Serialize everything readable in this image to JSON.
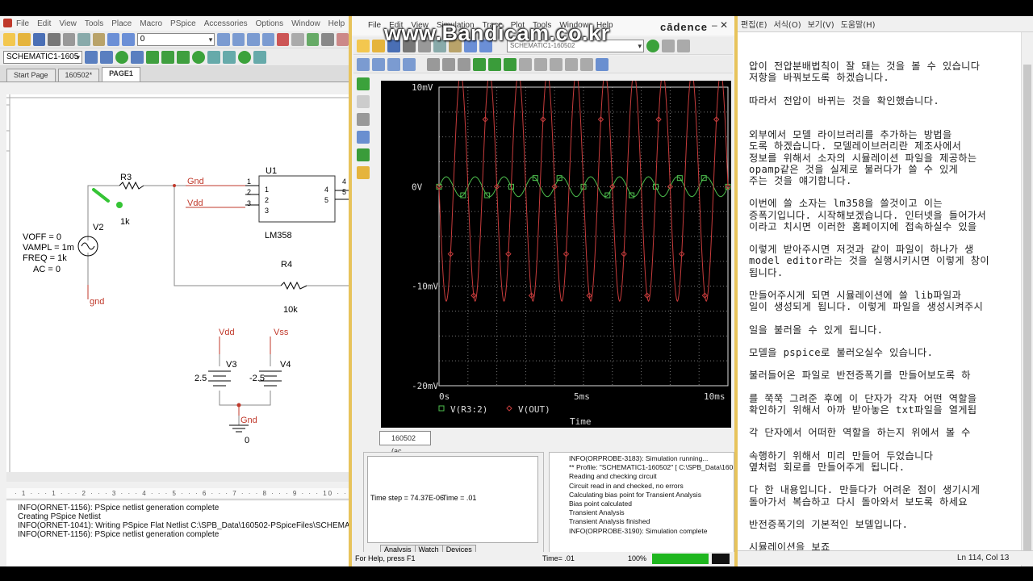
{
  "watermark": "www.Bandicam.co.kr",
  "capture": {
    "menu": [
      "File",
      "Edit",
      "View",
      "Tools",
      "Place",
      "Macro",
      "PSpice",
      "Accessories",
      "Options",
      "Window",
      "Help"
    ],
    "zoom_combo": "0",
    "schematic_combo": "SCHEMATIC1-1605",
    "tabs": [
      "Start Page",
      "160502*",
      "PAGE1"
    ],
    "parts": {
      "R3": "R3",
      "R3_value": "1k",
      "R4": "R4",
      "R4_value": "10k",
      "V2": "V2",
      "V3": "V3",
      "V4": "V4",
      "U1": "U1",
      "U1_model": "LM358",
      "voff": "VOFF = 0",
      "vampl": "VAMPL = 1m",
      "freq": "FREQ = 1k",
      "ac": "AC = 0",
      "v3_value": "2.5",
      "v4_value": "-2.5",
      "pin1": "1",
      "pin2": "2",
      "pin3": "3",
      "pin4": "4",
      "pin5": "5",
      "net_gnd": "Gnd",
      "net_vdd": "Vdd",
      "net_gnd_lower": "gnd",
      "net_vss": "Vss",
      "ground_zero": "0"
    },
    "log": [
      "INFO(ORNET-1156): PSpice netlist generation complete",
      "Creating PSpice Netlist",
      "INFO(ORNET-1041): Writing PSpice Flat Netlist C:\\SPB_Data\\160502-PSpiceFiles\\SCHEMATIC1\\",
      "INFO(ORNET-1156): PSpice netlist generation complete"
    ]
  },
  "pspice": {
    "menu": [
      "File",
      "Edit",
      "View",
      "Simulation",
      "Trace",
      "Plot",
      "Tools",
      "Window",
      "Help"
    ],
    "brand": "cādence",
    "profile_combo": "SCHEMATIC1-160502",
    "doc_tab": "160502 (ac...",
    "sim_panel": {
      "time_step": "Time step = 74.37E-06",
      "time": "Time = .01",
      "tabs": [
        "Analysis",
        "Watch",
        "Devices"
      ]
    },
    "output": [
      "INFO(ORPROBE-3183): Simulation running...",
      "** Profile: \"SCHEMATIC1-160502\"  [ C:\\SPB_Data\\160502-P",
      "Reading and checking circuit",
      "Circuit read in and checked, no errors",
      "Calculating bias point for Transient Analysis",
      "Bias point calculated",
      "Transient Analysis",
      "Transient Analysis finished",
      "INFO(ORPROBE-3190): Simulation complete"
    ],
    "status": {
      "help": "For Help, press F1",
      "time": "Time= .01",
      "percent": "100%"
    }
  },
  "chart_data": {
    "type": "line",
    "xlabel": "Time",
    "x_ticks": [
      "0s",
      "5ms",
      "10ms"
    ],
    "y_ticks": [
      "10mV",
      "0V",
      "-10mV",
      "-20mV"
    ],
    "xlim": [
      0,
      10
    ],
    "x_unit": "ms",
    "ylim": [
      -20,
      10
    ],
    "y_unit": "mV",
    "grid": true,
    "legend_position": "bottom-left",
    "series": [
      {
        "name": "V(R3:2)",
        "color": "#4ec04e",
        "marker": "square",
        "amplitude": 1,
        "offset": 0,
        "frequency_khz": 1
      },
      {
        "name": "V(OUT)",
        "color": "#c83c3c",
        "marker": "diamond",
        "amplitude": 11.5,
        "offset": 0,
        "frequency_khz": 1,
        "inverted": true
      }
    ]
  },
  "notepad": {
    "menu": [
      "편집(E)",
      "서식(O)",
      "보기(V)",
      "도움말(H)"
    ],
    "lines": [
      "압이 전압분배법칙이 잘 돼는 것을 볼 수 있습니다",
      "저항을 바꿔보도록 하겠습니다.",
      "",
      "따라서 전압이 바뀌는 것을 확인했습니다.",
      "",
      "",
      "외부에서 모델 라이브러리를 추가하는 방법을",
      "도록 하겠습니다. 모델레이브러리란 제조사에서",
      "정보를 위해서 소자의 시뮬레이션 파일을 제공하는",
      "opamp같은 것을 실제로 불러다가 쓸 수 있게",
      "주는 것을 얘기합니다.",
      "",
      "이번에 쓸 소자는 lm358을 쓸것이고 이는",
      "증폭기입니다. 시작해보겠습니다. 인터넷을 들어가서",
      "이라고 치시면 이러한 홈페이지에 접속하실수 있을",
      "",
      "이렇게 받아주시면 저것과 같이 파일이 하나가 생",
      "model editor라는 것을 실행시키시면 이렇게 창이",
      "됩니다.",
      "",
      "만들어주시게 되면 시뮬레이션에 쓸 lib파일과",
      "일이 생성되게 됩니다. 이렇게 파일을 생성시켜주시",
      "",
      "일을 불러올 수 있게 됩니다.",
      "",
      "모델을 pspice로 불러오실수 있습니다.",
      "",
      "불러들어온 파일로 반전증폭기를 만들어보도록 하",
      "",
      "를 쭉쭉 그려준 후에 이 단자가 각자 어떤 역할을",
      "확인하기 위해서 아까 받아놓은 txt파일을 열게됩",
      "",
      "각 단자에서 어떠한 역할을 하는지 위에서 볼 수",
      "",
      "속행하기 위해서 미리 만들어 두었습니다",
      "옆처럼 회로를 만들어주게 됩니다.",
      "",
      "다 한 내용입니다. 만들다가 어려운 점이 생기시게",
      "돌아가서 복습하고 다시 돌아와서 보도록 하세요",
      "",
      "반전증폭기의 기본적인 보델입니다.",
      "",
      "시뮬레이션을 보죠"
    ],
    "status": "Ln 114, Col 13"
  }
}
